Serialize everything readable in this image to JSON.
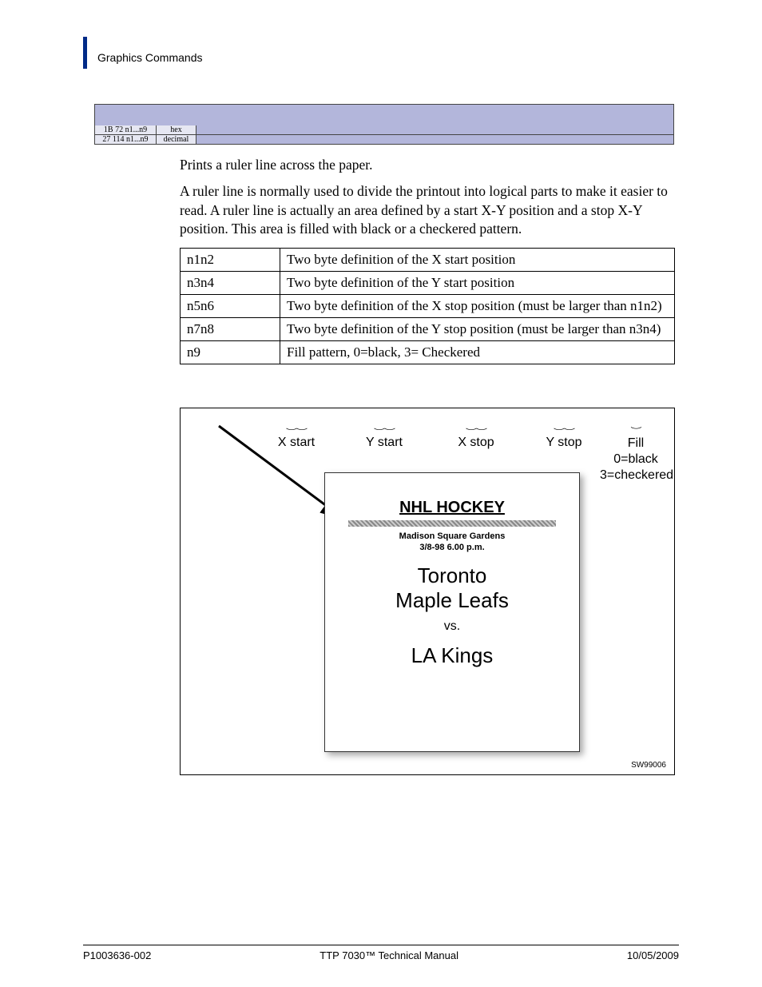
{
  "header": {
    "section": "Graphics Commands"
  },
  "command_codes": {
    "hex_val": "1B 72  n1...n9",
    "hex_label": "hex",
    "dec_val": "27 114  n1...n9",
    "dec_label": "decimal"
  },
  "para1": "Prints a ruler line across the paper.",
  "para2": "A ruler line is normally used to divide the printout into logical parts to make it easier to read. A ruler line is actually an area defined by a start X-Y position and a stop X-Y position. This area is filled with black or a checkered pattern.",
  "params": [
    {
      "name": "n1n2",
      "desc": "Two byte definition of the X start position"
    },
    {
      "name": "n3n4",
      "desc": "Two byte definition of the Y start position"
    },
    {
      "name": "n5n6",
      "desc": "Two byte definition of the X stop position (must be larger than n1n2)"
    },
    {
      "name": "n7n8",
      "desc": "Two byte definition of the Y stop position (must be larger than n3n4)"
    },
    {
      "name": "n9",
      "desc": "Fill pattern, 0=black, 3= Checkered"
    }
  ],
  "figure": {
    "labels": {
      "xstart": "X start",
      "ystart": "Y start",
      "xstop": "X stop",
      "ystop": "Y stop",
      "fill1": "Fill",
      "fill2": "0=black",
      "fill3": "3=checkered"
    },
    "ticket": {
      "title": "NHL HOCKEY",
      "venue": "Madison Square Gardens",
      "datetime": "3/8-98 6.00 p.m.",
      "team1": "Toronto",
      "team1b": "Maple Leafs",
      "vs": "vs.",
      "team2": "LA Kings"
    },
    "id": "SW99006"
  },
  "footer": {
    "left": "P1003636-002",
    "center": "TTP 7030™ Technical Manual",
    "right": "10/05/2009"
  }
}
